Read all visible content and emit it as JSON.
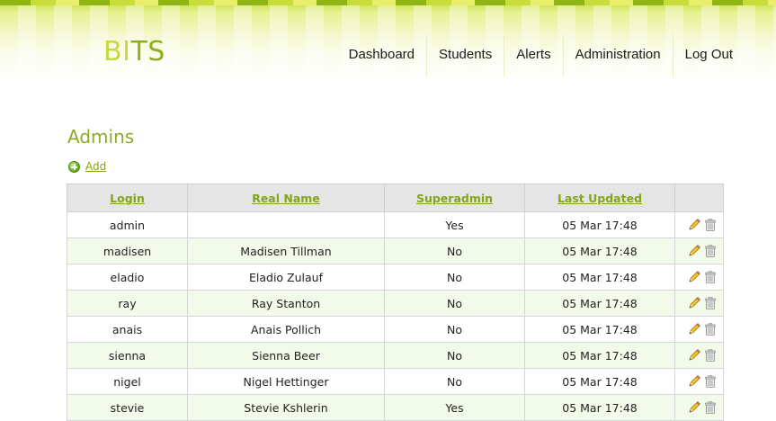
{
  "header": {
    "logo_part1": "BI",
    "logo_part2": "TS",
    "nav": [
      "Dashboard",
      "Students",
      "Alerts",
      "Administration",
      "Log Out"
    ]
  },
  "page": {
    "title": "Admins",
    "add_label": "Add"
  },
  "table": {
    "columns": [
      "Login",
      "Real Name",
      "Superadmin",
      "Last Updated"
    ],
    "rows": [
      {
        "login": "admin",
        "real_name": "",
        "superadmin": "Yes",
        "last_updated": "05 Mar 17:48"
      },
      {
        "login": "madisen",
        "real_name": "Madisen Tillman",
        "superadmin": "No",
        "last_updated": "05 Mar 17:48"
      },
      {
        "login": "eladio",
        "real_name": "Eladio Zulauf",
        "superadmin": "No",
        "last_updated": "05 Mar 17:48"
      },
      {
        "login": "ray",
        "real_name": "Ray Stanton",
        "superadmin": "No",
        "last_updated": "05 Mar 17:48"
      },
      {
        "login": "anais",
        "real_name": "Anais Pollich",
        "superadmin": "No",
        "last_updated": "05 Mar 17:48"
      },
      {
        "login": "sienna",
        "real_name": "Sienna Beer",
        "superadmin": "No",
        "last_updated": "05 Mar 17:48"
      },
      {
        "login": "nigel",
        "real_name": "Nigel Hettinger",
        "superadmin": "No",
        "last_updated": "05 Mar 17:48"
      },
      {
        "login": "stevie",
        "real_name": "Stevie Kshlerin",
        "superadmin": "Yes",
        "last_updated": "05 Mar 17:48"
      }
    ],
    "row_actions": [
      "pencil-icon",
      "trash-icon"
    ]
  },
  "colors": {
    "accent": "#84a41a",
    "logo_light": "#c4da3c",
    "logo_dark": "#8fb01e",
    "row_alt": "#f2fbea",
    "header_cell": "#e5e5e5"
  }
}
